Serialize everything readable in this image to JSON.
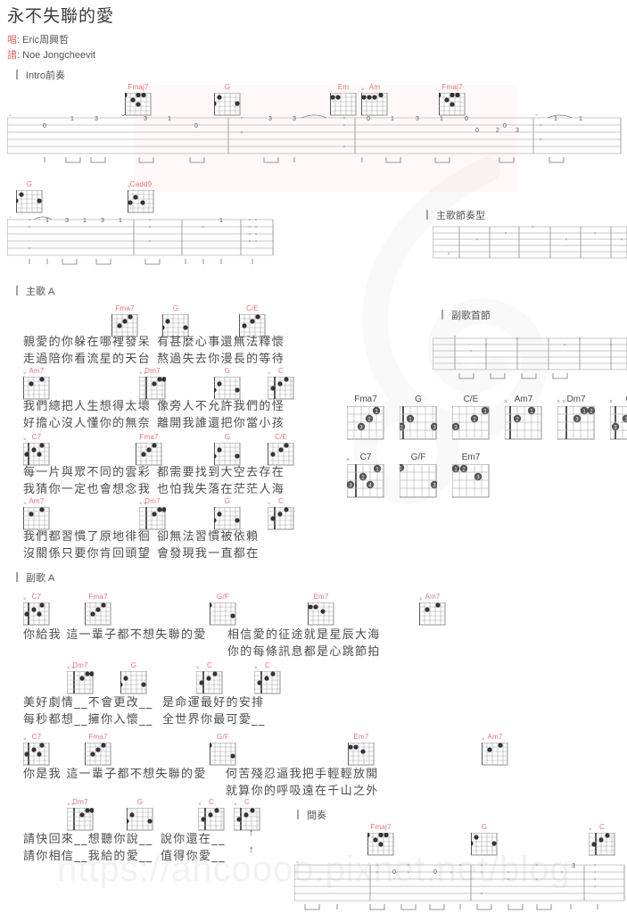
{
  "song": {
    "title": "永不失聯的愛",
    "singer_key": "唱",
    "singer": "Eric周興哲",
    "arranger_key": "譜",
    "arranger": "Noe Jongcheevit"
  },
  "watermark": {
    "url": "https://ahcoooo.pixnet.net/blog"
  },
  "sections": {
    "intro": "Intro前奏",
    "verse_rhythm": "主歌節奏型",
    "verse_a": "主歌 A",
    "chorus_first_bar": "副歌首節",
    "chorus_a": "副歌 A",
    "interlude": "間奏"
  },
  "intro_chords_line1": [
    "Fmaj7",
    "G",
    "Em",
    "Am",
    "Fmaj7"
  ],
  "intro_chords_line2": [
    "G",
    "Cadd9"
  ],
  "interlude_chords": [
    "Fmaj7",
    "G",
    "C"
  ],
  "verse": [
    {
      "chords": [
        "Fma7",
        "G",
        "C/E"
      ],
      "line1_left": "親愛的你躲在哪裡發呆",
      "line1_right": "有甚麼心事還無法釋懷",
      "line2_left": "走過陪你看流星的天台",
      "line2_right": "熬過失去你漫長的等待"
    },
    {
      "chords": [
        "Am7",
        "Dm7",
        "G",
        "C"
      ],
      "line1_left": "我們總把人生想得太壞",
      "line1_right": "像旁人不允許我們的怪",
      "line2_left": "好擔心沒人懂你的無奈",
      "line2_right": "離開我誰還把你當小孩"
    },
    {
      "chords": [
        "C7",
        "Fma7",
        "G",
        "C/E"
      ],
      "line1_left": "每一片與眾不同的雲彩",
      "line1_right": "都需要找到大空去存在",
      "line2_left": "我猜你一定也會想念我",
      "line2_right": "也怕我失落在茫茫人海"
    },
    {
      "chords": [
        "Am7",
        "Dm7",
        "G",
        "C"
      ],
      "line1_left": "我們都習慣了原地徘徊",
      "line1_right": "卻無法習慣被依賴",
      "line2_left": "沒關係只要你肯回頭望",
      "line2_right": "會發現我一直都在"
    }
  ],
  "chorus": [
    {
      "chords": [
        "C7",
        "Fma7",
        "G/F",
        "Em7",
        "Am7"
      ],
      "line1_left": "你給我 這一輩子都不想失聯的愛",
      "line1_right": "相信愛的征途就是星辰大海",
      "line2_right": "你的每條訊息都是心跳節拍"
    },
    {
      "chords": [
        "Dm7",
        "G",
        "C",
        "C"
      ],
      "line1_left": "美好劇情__不會更改__",
      "line1_right": "是命運最好的安排",
      "line2_left": "每秒都想__擁你入懷__",
      "line2_right": "全世界你最可愛__"
    },
    {
      "chords": [
        "C7",
        "Fma7",
        "G/F",
        "Em7",
        "Am7"
      ],
      "line1_left": "你是我 這一輩子都不想失聯的愛",
      "line1_right": "何苦殘忍逼我把手輕輕放開",
      "line2_right": "就算你的呼吸遠在千山之外"
    },
    {
      "chords": [
        "Dm7",
        "G",
        "C",
        "C"
      ],
      "line1_left": "請快回來__想聽你說__",
      "line1_right": "說你還在__",
      "line2_left": "請你相信__我給的愛__",
      "line2_right": "值得你愛__"
    }
  ],
  "chord_reference": {
    "row1": [
      {
        "name": "Fma7",
        "mutes": ""
      },
      {
        "name": "G",
        "mutes": ""
      },
      {
        "name": "C/E",
        "mutes": ""
      },
      {
        "name": "Am7",
        "mutes": "×"
      },
      {
        "name": "Dm7",
        "mutes": "××"
      },
      {
        "name": "C",
        "mutes": "×"
      }
    ],
    "row2": [
      {
        "name": "C7",
        "mutes": "×"
      },
      {
        "name": "G/F",
        "mutes": ""
      },
      {
        "name": "Em7",
        "mutes": ""
      }
    ]
  },
  "colors": {
    "chord_label": "#e8747a",
    "text": "#4d4d4d",
    "staff": "#b9b9b9",
    "accent_bar": "#9aa4ae"
  }
}
